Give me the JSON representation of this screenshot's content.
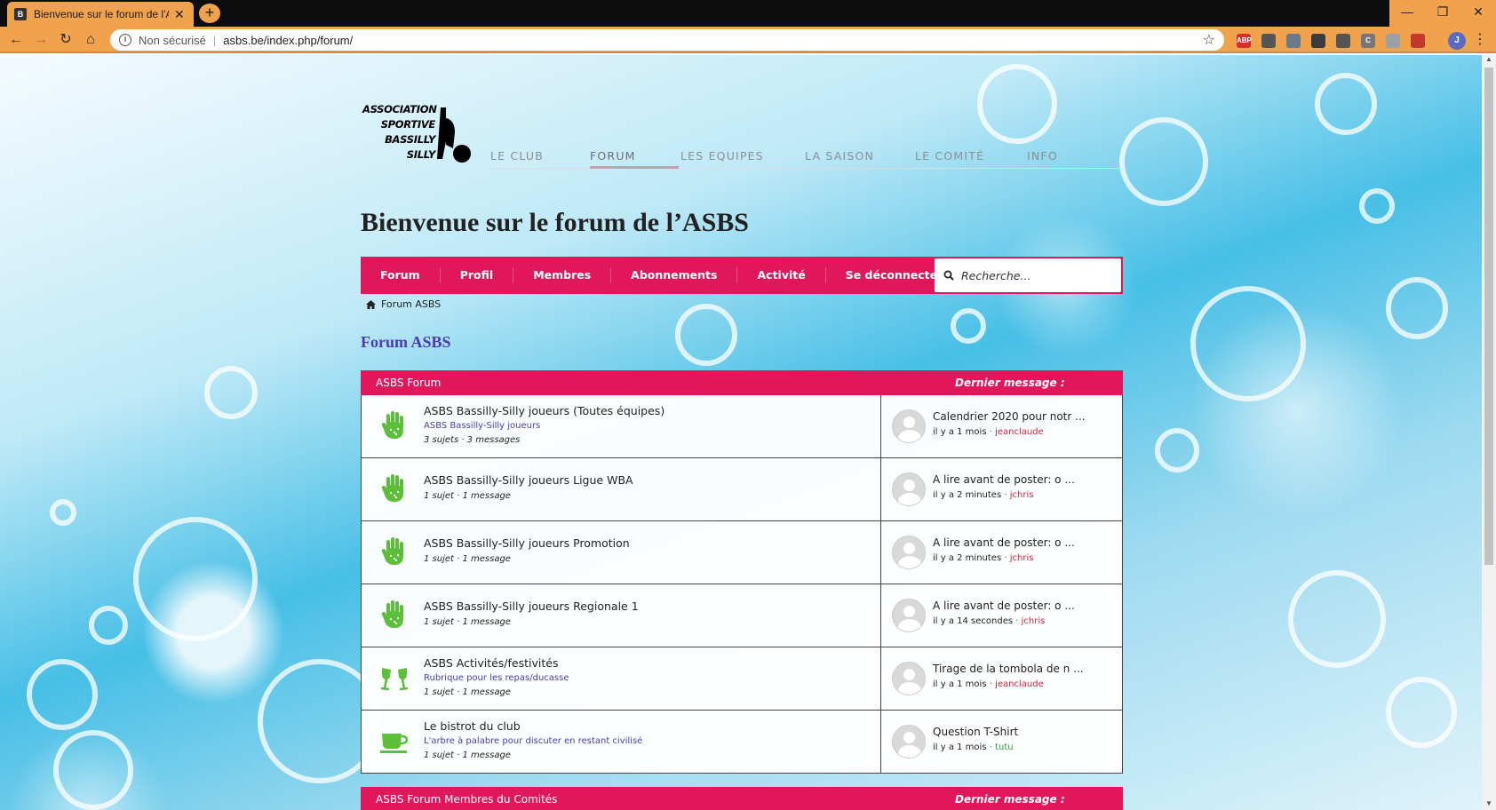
{
  "browser": {
    "tab_title": "Bienvenue sur le forum de l'ASBS",
    "tab_favicon_label": "B",
    "security_label": "Non sécurisé",
    "url": "asbs.be/index.php/forum/",
    "extensions": [
      {
        "label": "ABP",
        "color": "#d32f2f"
      },
      {
        "label": "",
        "color": "#555555"
      },
      {
        "label": "",
        "color": "#6a7b8c"
      },
      {
        "label": "",
        "color": "#3b3b3b"
      },
      {
        "label": "",
        "color": "#555555"
      },
      {
        "label": "C",
        "color": "#777777"
      },
      {
        "label": "",
        "color": "#9aa0a6"
      },
      {
        "label": "",
        "color": "#c0392b"
      }
    ],
    "profile_initial": "J"
  },
  "site": {
    "logo_lines": [
      "ASSOCIATION",
      "SPORTIVE",
      "BASSILLY",
      "SILLY"
    ],
    "nav": [
      "LE CLUB",
      "FORUM",
      "LES EQUIPES",
      "LA SAISON",
      "LE COMITÉ",
      "INFO"
    ],
    "nav_active": "FORUM",
    "page_heading": "Bienvenue sur le forum de l’ASBS"
  },
  "forum_nav": {
    "items": [
      "Forum",
      "Profil",
      "Membres",
      "Abonnements",
      "Activité",
      "Se déconnecter"
    ],
    "search_placeholder": "Recherche..."
  },
  "breadcrumb": {
    "label": "Forum ASBS"
  },
  "forum": {
    "title": "Forum ASBS",
    "section1": {
      "header": "ASBS Forum",
      "last_header": "Dernier message :",
      "rows": [
        {
          "icon": "hand",
          "title": "ASBS Bassilly-Silly joueurs (Toutes équipes)",
          "desc": "ASBS Bassilly-Silly joueurs",
          "stats": "3 sujets · 3 messages",
          "last_title": "Calendrier 2020 pour notr ...",
          "last_time": "il y a 1 mois",
          "last_author": "jeanclaude",
          "author_color": "red"
        },
        {
          "icon": "hand",
          "title": "ASBS Bassilly-Silly joueurs Ligue WBA",
          "desc": "",
          "stats": "1 sujet · 1 message",
          "last_title": "A lire avant de poster: o ...",
          "last_time": "il y a 2 minutes",
          "last_author": "jchris",
          "author_color": "red"
        },
        {
          "icon": "hand",
          "title": "ASBS Bassilly-Silly joueurs Promotion",
          "desc": "",
          "stats": "1 sujet · 1 message",
          "last_title": "A lire avant de poster: o ...",
          "last_time": "il y a 2 minutes",
          "last_author": "jchris",
          "author_color": "red"
        },
        {
          "icon": "hand",
          "title": "ASBS Bassilly-Silly joueurs Regionale 1",
          "desc": "",
          "stats": "1 sujet · 1 message",
          "last_title": "A lire avant de poster: o ...",
          "last_time": "il y a 14 secondes",
          "last_author": "jchris",
          "author_color": "red"
        },
        {
          "icon": "glasses",
          "title": "ASBS Activités/festivités",
          "desc": "Rubrique pour les repas/ducasse",
          "stats": "1 sujet · 1 message",
          "last_title": "Tirage de la tombola de n ...",
          "last_time": "il y a 1 mois",
          "last_author": "jeanclaude",
          "author_color": "red"
        },
        {
          "icon": "cup",
          "title": "Le bistrot du club",
          "desc": "L'arbre à palabre pour discuter en restant civilisé",
          "stats": "1 sujet · 1 message",
          "last_title": "Question T-Shirt",
          "last_time": "il y a 1 mois",
          "last_author": "tutu",
          "author_color": "green"
        }
      ]
    },
    "section2": {
      "header": "ASBS Forum Membres du Comités",
      "last_header": "Dernier message :"
    }
  }
}
